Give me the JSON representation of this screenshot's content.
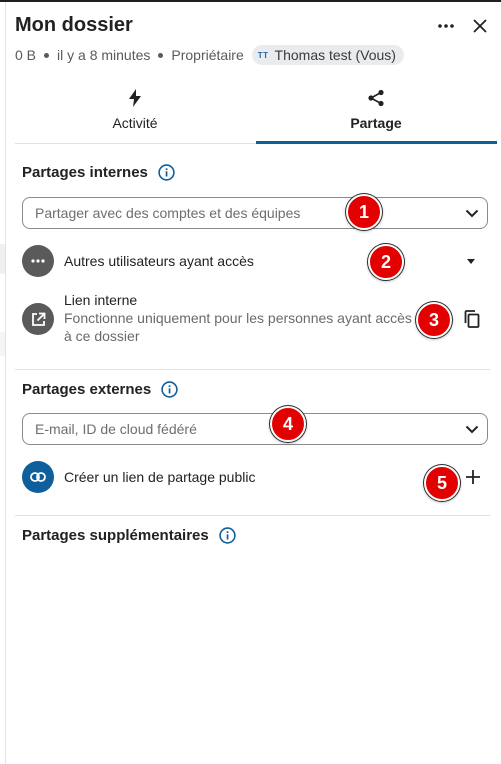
{
  "header": {
    "title": "Mon dossier",
    "size": "0 B",
    "modified": "il y a 8 minutes",
    "role": "Propriétaire",
    "owner_initials": "TT",
    "owner_name": "Thomas test (Vous)"
  },
  "tabs": [
    {
      "label": "Activité",
      "icon": "lightning-icon",
      "active": false
    },
    {
      "label": "Partage",
      "icon": "share-icon",
      "active": true
    }
  ],
  "internal": {
    "title": "Partages internes",
    "search_placeholder": "Partager avec des comptes et des équipes",
    "other_users_label": "Autres utilisateurs ayant accès",
    "internal_link_title": "Lien interne",
    "internal_link_desc": "Fonctionne uniquement pour les personnes ayant accès à ce dossier"
  },
  "external": {
    "title": "Partages externes",
    "search_placeholder": "E-mail, ID de cloud fédéré",
    "create_link_label": "Créer un lien de partage public"
  },
  "additional": {
    "title": "Partages supplémentaires"
  },
  "badges": [
    "1",
    "2",
    "3",
    "4",
    "5"
  ],
  "colors": {
    "accent": "#0f5f9c",
    "badge": "#e20000",
    "icon_gray": "#5a5a5a"
  }
}
